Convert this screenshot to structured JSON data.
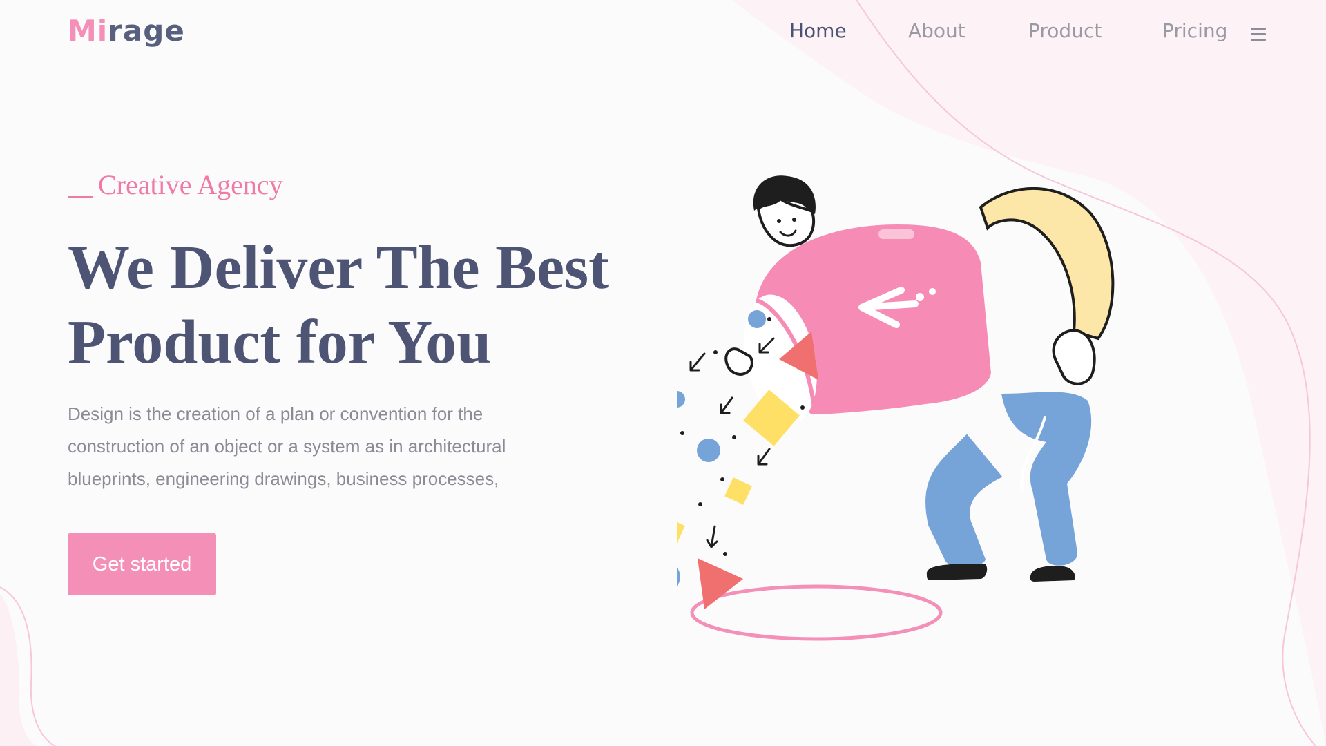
{
  "brand": {
    "logo_accent": "Mi",
    "logo_rest": "rage"
  },
  "nav": {
    "home": "Home",
    "about": "About",
    "product": "Product",
    "pricing": "Pricing",
    "menu_icon": "hamburger-menu-icon"
  },
  "hero": {
    "eyebrow": "Creative Agency",
    "headline_line1": "We Deliver The Best",
    "headline_line2": "Product for You",
    "description": "Design is the creation of a plan or convention for the construction of an object or a system as in architectural blueprints, engineering drawings, business processes,",
    "cta_label": "Get started"
  },
  "colors": {
    "accent_pink": "#f48fb8",
    "heading": "#4e5474",
    "body_text": "#8a8b95",
    "nav_active": "#4b5272",
    "nav_inactive": "#9a9aa3",
    "blue": "#76a3d8",
    "yellow": "#ffe066",
    "red": "#f07070",
    "sleeve": "#fce6a8"
  }
}
